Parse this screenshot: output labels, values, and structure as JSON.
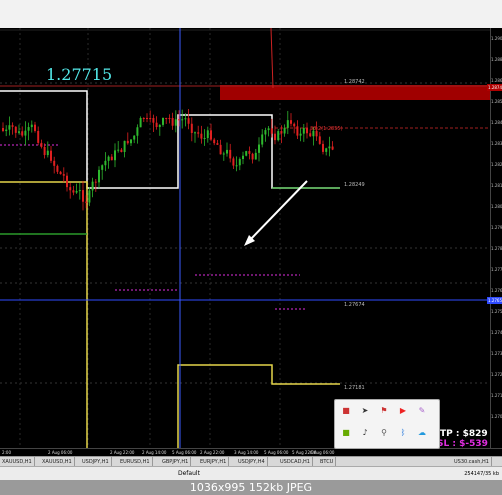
{
  "price_label": "1.27715",
  "horizontal_labels": [
    "1.28742",
    "1.28249",
    "1.27674",
    "1.27181"
  ],
  "fib_label": "38.2(1.2855)",
  "price_axis_ticks": [
    "1.290",
    "1.288",
    "1.286",
    "1.285",
    "1.284",
    "1.283",
    "1.282",
    "1.281",
    "1.280",
    "1.279",
    "1.278",
    "1.277",
    "1.276",
    "1.275",
    "1.274",
    "1.273",
    "1.272",
    "1.271",
    "1.270"
  ],
  "highlighted_prices": {
    "top": "1.2874",
    "current": "1.2765"
  },
  "date_ticks": [
    "2:00",
    "2 Aug 06:00",
    "2 Aug 22:00",
    "2 Aug 14:00",
    "5 Aug 06:00",
    "2 Aug 22:00",
    "3 Aug 14:00",
    "5 Aug 06:00",
    "5 Aug 22:00",
    "6 Aug 06:00"
  ],
  "tabs": [
    {
      "label": "XAUUSD,H1",
      "active": false
    },
    {
      "label": "XAUUSD,H1",
      "active": false
    },
    {
      "label": "USDJPY,H1",
      "active": false
    },
    {
      "label": "EURUSD,H1",
      "active": false
    },
    {
      "label": "GBPJPY,H1",
      "active": false
    },
    {
      "label": "EURJPY,H1",
      "active": false
    },
    {
      "label": "USDJPY,H4",
      "active": false
    },
    {
      "label": "USDCAD,H1",
      "active": false
    },
    {
      "label": "BTCU",
      "active": false
    },
    {
      "label": "US30.cash,H1",
      "active": false
    }
  ],
  "profile": "Default",
  "memory": "254147/35 kb",
  "tp_text": "TP : $829",
  "sl_text": "SL : $-539",
  "caption": "1036x995  152kb  JPEG",
  "tray_icons": [
    "red-app-icon",
    "send-icon",
    "flag-icon",
    "youtube-icon",
    "pen-icon",
    "nvidia-icon",
    "volume-icon",
    "usb-icon",
    "bluetooth-icon",
    "cloud-icon"
  ],
  "colors": {
    "background": "#000000",
    "bull": "#2eb82e",
    "bear": "#e02020",
    "price_line": "#2f4bff",
    "label": "#53e9e9",
    "sl": "#e02ee0"
  }
}
